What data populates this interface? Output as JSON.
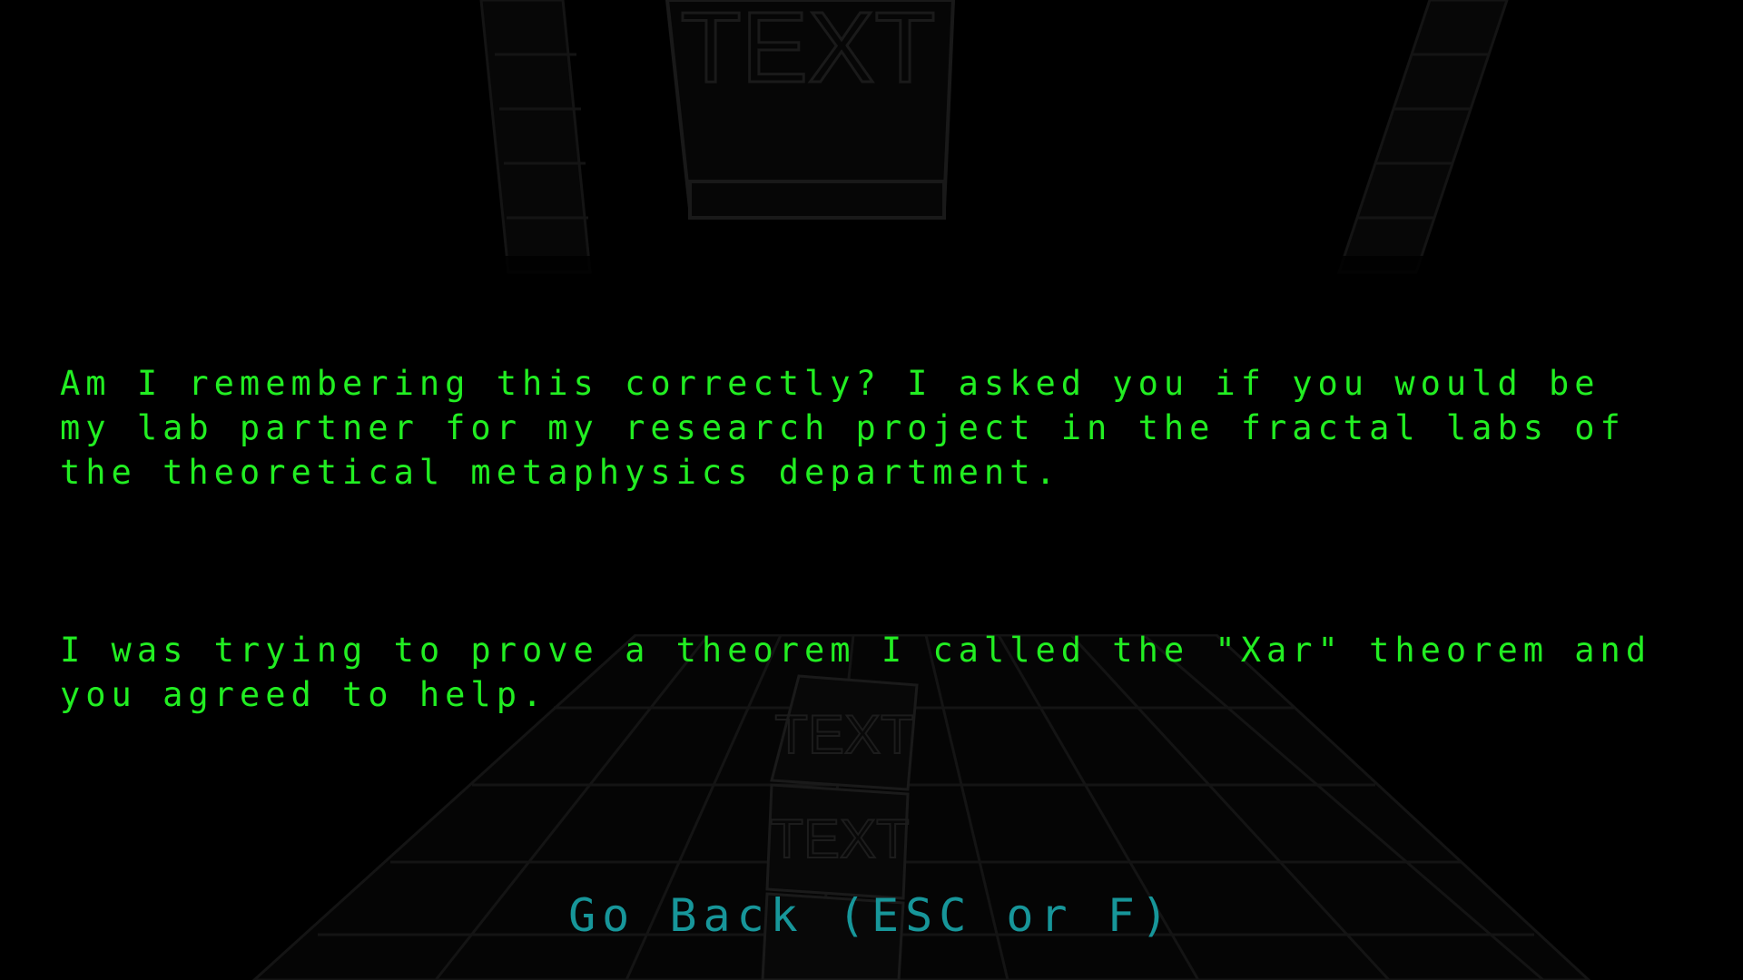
{
  "dialog": {
    "paragraphs": [
      "Am I remembering this correctly? I asked you if you would be my lab partner for my research project in the fractal labs of the theoretical metaphysics department.",
      "I was trying to prove a theorem I called the \"Xar\" theorem and you agreed to help."
    ]
  },
  "navigation": {
    "go_back_label": "Go Back (ESC or F)"
  },
  "background": {
    "cube_labels": [
      "TEXT",
      "TEXT",
      "TEXT"
    ]
  },
  "colors": {
    "dialog_text": "#22ee22",
    "go_back_text": "#17969a",
    "background": "#000000"
  }
}
